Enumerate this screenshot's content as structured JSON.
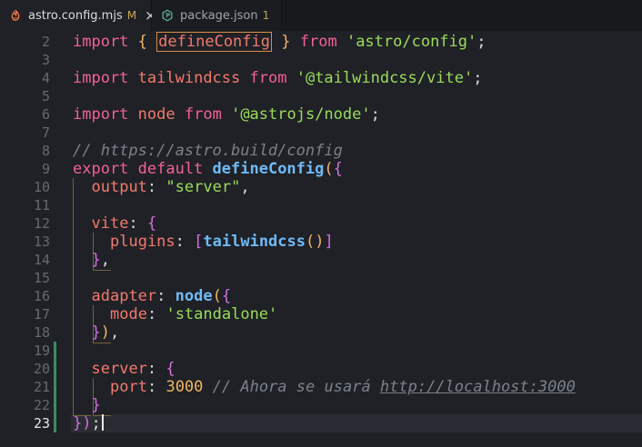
{
  "tabs": [
    {
      "filename": "astro.config.mjs",
      "status": "M",
      "close_symbol": "×",
      "icon": "astro-file-icon",
      "active": true
    },
    {
      "filename": "package.json",
      "status": "1",
      "icon": "package-json-file-icon",
      "active": false
    }
  ],
  "colors": {
    "background": "#1f2126",
    "tabbar": "#17191d",
    "keyword": "#f2609a",
    "identifier": "#f3796c",
    "function": "#6fbaf5",
    "string": "#9bdc5b",
    "number": "#f3b463",
    "comment": "#7a818b",
    "git_added": "#3e8a66",
    "current_line": "#292c32"
  },
  "editor": {
    "line_numbers": [
      "2",
      "3",
      "4",
      "5",
      "6",
      "7",
      "8",
      "9",
      "10",
      "11",
      "12",
      "13",
      "14",
      "15",
      "16",
      "17",
      "18",
      "19",
      "20",
      "21",
      "22",
      "23"
    ],
    "current_line": "23",
    "tokens": {
      "import": "import",
      "from": "from",
      "brace_open": "{",
      "brace_close": "}",
      "space": " ",
      "define_config": "defineConfig",
      "astro_config": "'astro/config'",
      "semicolon": ";",
      "tailwindcss": "tailwindcss",
      "tailwind_vite": "'@tailwindcss/vite'",
      "node": "node",
      "astro_node": "'@astrojs/node'",
      "comment_url": "// https://astro.build/config",
      "export_default": "export default",
      "paren_open": "(",
      "paren_close": ")",
      "output": "output",
      "colon": ":",
      "server_string": "\"server\"",
      "comma": ",",
      "vite": "vite",
      "plugins": "plugins",
      "bracket_open": "[",
      "bracket_close": "]",
      "empty_call": "()",
      "adapter": "adapter",
      "mode": "mode",
      "standalone": "'standalone'",
      "server": "server",
      "port": "port",
      "port_value": "3000",
      "comment_prefix": "// Ahora se usará ",
      "localhost_url": "http://localhost:3000",
      "final_close": "})",
      "final_semicolon": ";"
    }
  }
}
